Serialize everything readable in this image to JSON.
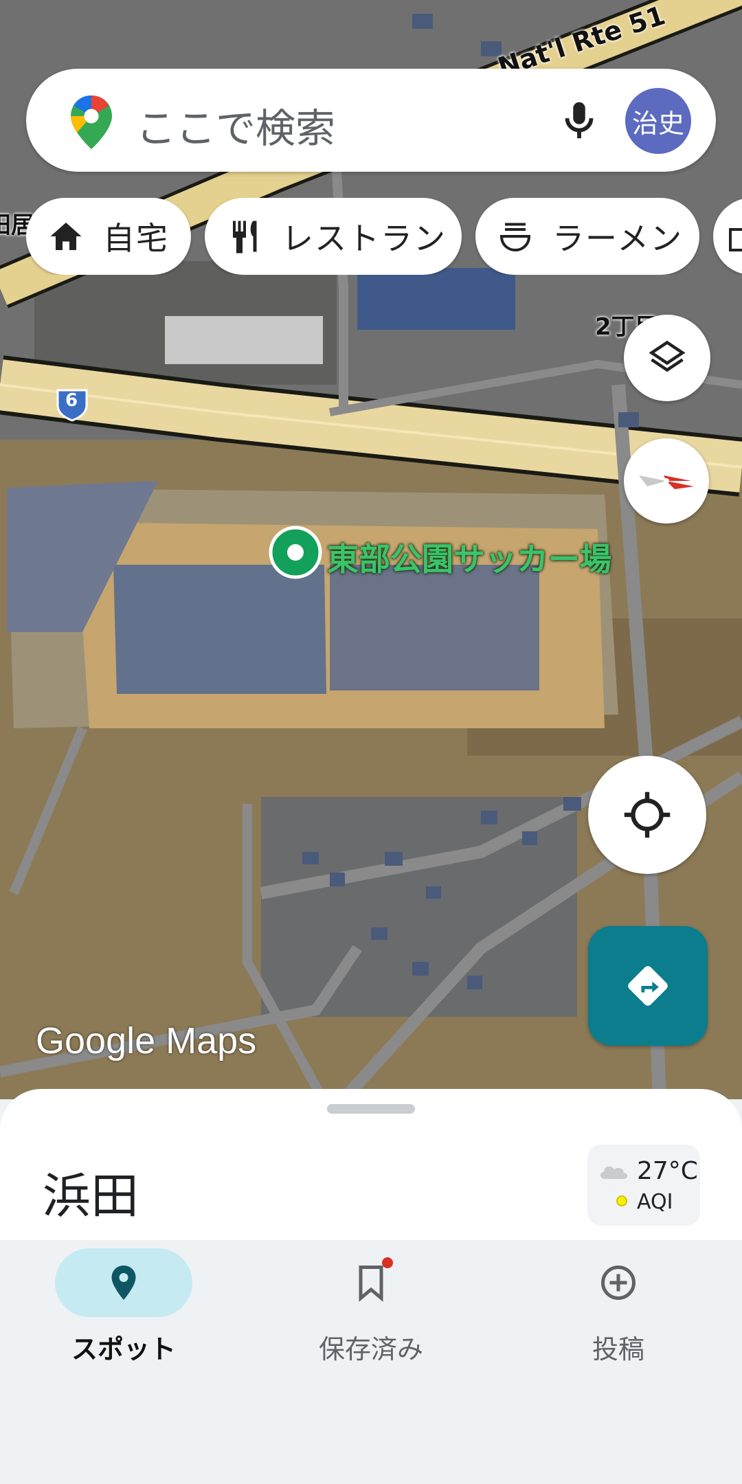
{
  "search": {
    "placeholder": "ここで検索",
    "avatar_text": "治史"
  },
  "chips": [
    {
      "label": "自宅",
      "icon": "home-icon"
    },
    {
      "label": "レストラン",
      "icon": "fork-knife-icon"
    },
    {
      "label": "ラーメン",
      "icon": "ramen-bowl-icon"
    }
  ],
  "map": {
    "road_label": "Nat'l Rte 51",
    "route_shield": "6",
    "block_label": "2丁目",
    "place_label": "東部公園サッカー場",
    "watermark": "Google Maps",
    "left_cut_label": "田居"
  },
  "sheet": {
    "locality": "浜田",
    "temperature": "27°C",
    "aqi_label": "AQI"
  },
  "nav": [
    {
      "label": "スポット",
      "icon": "location-pin-icon",
      "active": true
    },
    {
      "label": "保存済み",
      "icon": "bookmark-icon",
      "active": false
    },
    {
      "label": "投稿",
      "icon": "add-circle-icon",
      "active": false
    }
  ],
  "colors": {
    "accent": "#0b7d8d",
    "nav_active_pill": "#c6eaf2",
    "avatar_bg": "#5c6bc0",
    "place_marker": "#13a05a",
    "badge": "#d93025"
  }
}
